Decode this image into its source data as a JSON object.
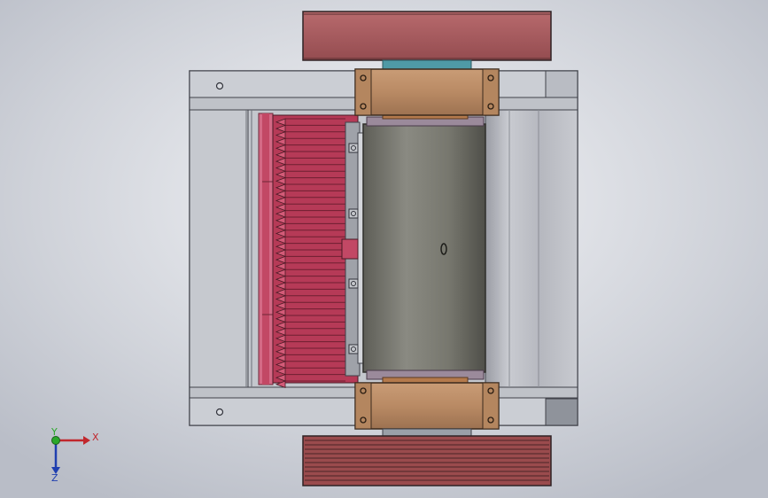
{
  "viewport": {
    "background_colors": [
      "#b9bdc7",
      "#cfd2d9",
      "#f4f5f8"
    ]
  },
  "colors": {
    "frame_fill": "#c8cbd1",
    "frame_edge": "#40424a",
    "pulley_top": "#a6585c",
    "bearing_housing": "#b98a64",
    "roller": "#77776e",
    "blade_pink": "#c24865",
    "blade_dark": "#8c2b3f",
    "v_belt_pulley": "#9a4b4d",
    "axis_x": "#c1272d",
    "axis_y": "#2aa82a",
    "axis_z": "#1f3fb0"
  },
  "triad": {
    "x_label": "X",
    "y_label": "Y",
    "z_label": "Z"
  }
}
